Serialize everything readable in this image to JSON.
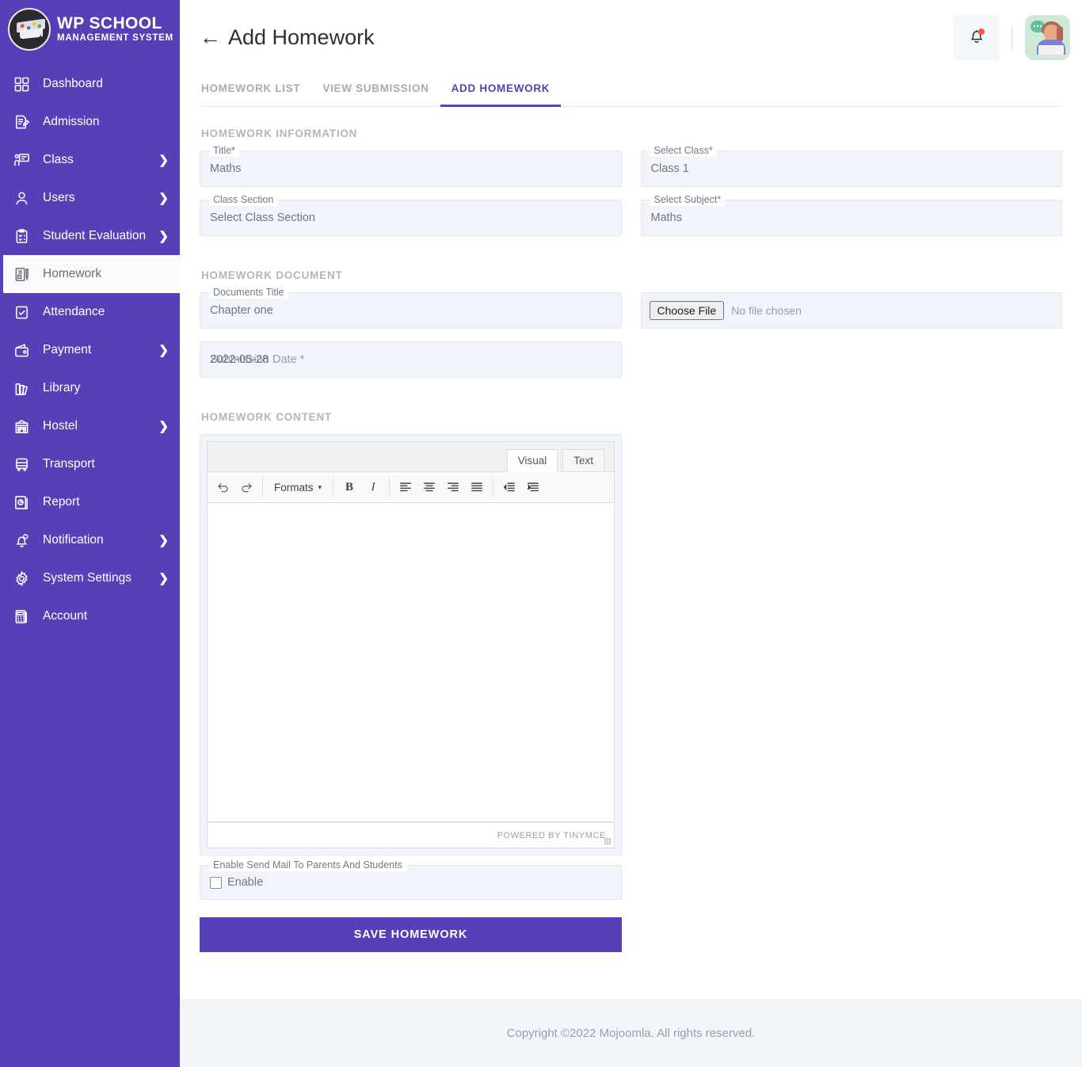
{
  "brand": {
    "title": "WP SCHOOL",
    "subtitle": "MANAGEMENT SYSTEM",
    "logo_icon": "graduation-cap-logo"
  },
  "sidebar": {
    "items": [
      {
        "label": "Dashboard",
        "icon": "grid-icon",
        "has_submenu": false,
        "active": false
      },
      {
        "label": "Admission",
        "icon": "form-pencil-icon",
        "has_submenu": false,
        "active": false
      },
      {
        "label": "Class",
        "icon": "classroom-icon",
        "has_submenu": true,
        "active": false
      },
      {
        "label": "Users",
        "icon": "user-icon",
        "has_submenu": true,
        "active": false
      },
      {
        "label": "Student Evaluation",
        "icon": "clipboard-check-icon",
        "has_submenu": true,
        "active": false
      },
      {
        "label": "Homework",
        "icon": "notebook-pen-icon",
        "has_submenu": false,
        "active": true
      },
      {
        "label": "Attendance",
        "icon": "checklist-icon",
        "has_submenu": false,
        "active": false
      },
      {
        "label": "Payment",
        "icon": "wallet-icon",
        "has_submenu": true,
        "active": false
      },
      {
        "label": "Library",
        "icon": "books-icon",
        "has_submenu": false,
        "active": false
      },
      {
        "label": "Hostel",
        "icon": "building-icon",
        "has_submenu": true,
        "active": false
      },
      {
        "label": "Transport",
        "icon": "bus-icon",
        "has_submenu": false,
        "active": false
      },
      {
        "label": "Report",
        "icon": "report-chart-icon",
        "has_submenu": false,
        "active": false
      },
      {
        "label": "Notification",
        "icon": "bell-clock-icon",
        "has_submenu": true,
        "active": false
      },
      {
        "label": "System Settings",
        "icon": "gear-icon",
        "has_submenu": true,
        "active": false
      },
      {
        "label": "Account",
        "icon": "calculator-icon",
        "has_submenu": false,
        "active": false
      }
    ],
    "chevron": "❯"
  },
  "header": {
    "back_arrow": "←",
    "title": "Add Homework",
    "bell_icon": "bell-icon",
    "has_notification_dot": true,
    "avatar_icon": "support-agent-avatar"
  },
  "tabs": [
    {
      "label": "HOMEWORK LIST",
      "active": false
    },
    {
      "label": "VIEW SUBMISSION",
      "active": false
    },
    {
      "label": "ADD HOMEWORK",
      "active": true
    }
  ],
  "sections": {
    "information": "HOMEWORK INFORMATION",
    "document": "HOMEWORK DOCUMENT",
    "content": "HOMEWORK CONTENT"
  },
  "form": {
    "title": {
      "label": "Title*",
      "value": "Maths"
    },
    "select_class": {
      "label": "Select Class*",
      "value": "Class 1"
    },
    "class_section": {
      "label": "Class Section",
      "value": "Select Class Section"
    },
    "select_subject": {
      "label": "Select Subject*",
      "value": "Maths"
    },
    "documents_title": {
      "label": "Documents Title",
      "value": "Chapter one"
    },
    "submission_date": {
      "label": "Submission Date *",
      "value": "2022-05-28"
    },
    "file_upload": {
      "button": "Choose File",
      "status": "No file chosen"
    },
    "enable_mail": {
      "label": "Enable Send Mail To Parents And Students",
      "checkbox_label": "Enable",
      "checked": false
    }
  },
  "editor": {
    "tabs": [
      {
        "label": "Visual",
        "active": true
      },
      {
        "label": "Text",
        "active": false
      }
    ],
    "toolbar": {
      "undo": "undo-icon",
      "redo": "redo-icon",
      "formats_label": "Formats",
      "formats_caret": "▾",
      "bold": "B",
      "italic": "I",
      "align_left": "align-left-icon",
      "align_center": "align-center-icon",
      "align_right": "align-right-icon",
      "align_justify": "align-justify-icon",
      "outdent": "outdent-icon",
      "indent": "indent-icon"
    },
    "body_text": "",
    "status": "POWERED BY TINYMCE"
  },
  "actions": {
    "save": "SAVE HOMEWORK"
  },
  "footer": {
    "text": "Copyright ©2022 Mojoomla. All rights reserved."
  },
  "colors": {
    "sidebar": "#5740b7",
    "accent": "#5740b7",
    "field_bg": "#f1f4fa",
    "footer_bg": "#f2f5fa",
    "notification_dot": "#f4553d"
  }
}
